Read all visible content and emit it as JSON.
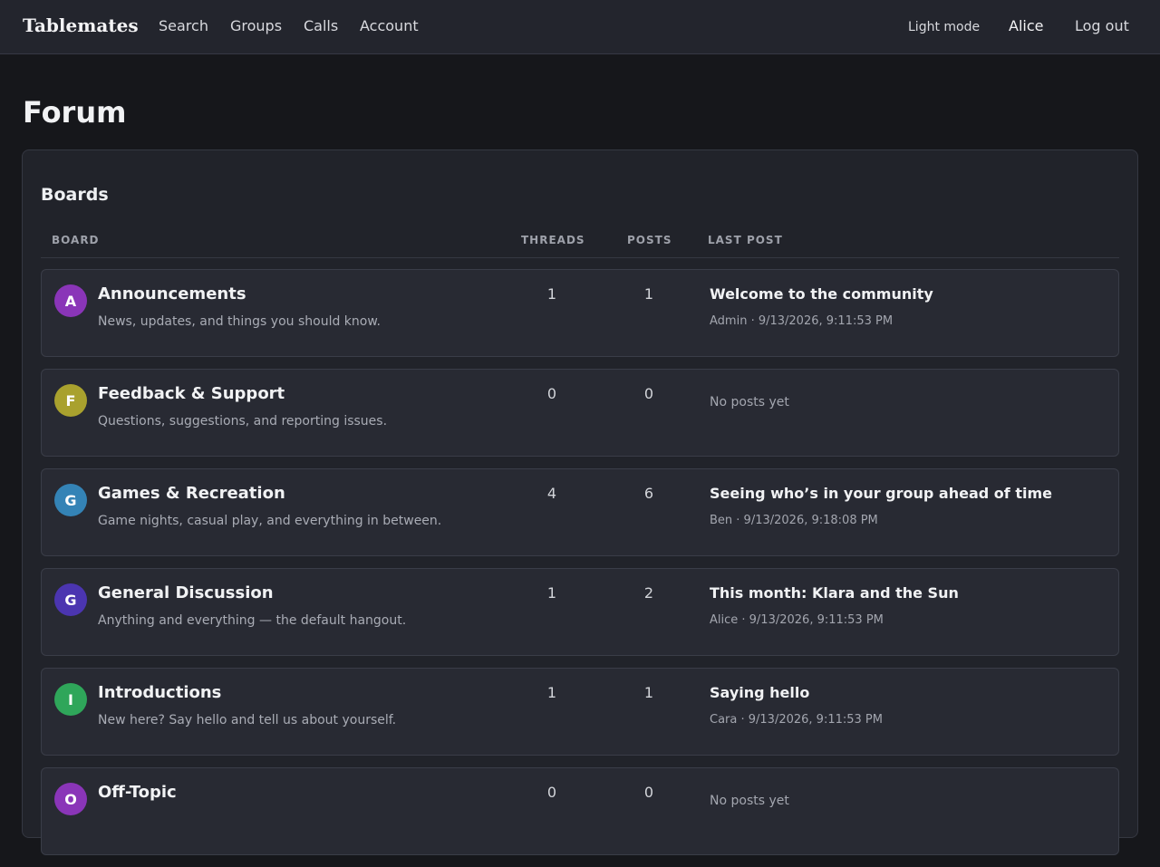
{
  "header": {
    "brand": "Tablemates",
    "nav": [
      "Search",
      "Groups",
      "Calls",
      "Account"
    ],
    "light_mode": "Light mode",
    "user": "Alice",
    "logout": "Log out"
  },
  "page": {
    "title": "Forum"
  },
  "boards": {
    "title": "Boards",
    "columns": [
      "BOARD",
      "THREADS",
      "POSTS",
      "LAST POST"
    ],
    "rows": [
      {
        "initial": "A",
        "color": "#8a35b8",
        "name": "Announcements",
        "desc": "News, updates, and things you should know.",
        "threads": "1",
        "posts": "1",
        "last_title": "Welcome to the community",
        "last_meta": "Admin · 9/13/2026, 9:11:53 PM"
      },
      {
        "initial": "F",
        "color": "#a9a12e",
        "name": "Feedback & Support",
        "desc": "Questions, suggestions, and reporting issues.",
        "threads": "0",
        "posts": "0",
        "last_title": "",
        "last_meta": "",
        "no_posts": "No posts yet"
      },
      {
        "initial": "G",
        "color": "#3483b6",
        "name": "Games & Recreation",
        "desc": "Game nights, casual play, and everything in between.",
        "threads": "4",
        "posts": "6",
        "last_title": "Seeing who’s in your group ahead of time",
        "last_meta": "Ben · 9/13/2026, 9:18:08 PM"
      },
      {
        "initial": "G",
        "color": "#4b35b0",
        "name": "General Discussion",
        "desc": "Anything and everything — the default hangout.",
        "threads": "1",
        "posts": "2",
        "last_title": "This month: Klara and the Sun",
        "last_meta": "Alice · 9/13/2026, 9:11:53 PM"
      },
      {
        "initial": "I",
        "color": "#2fa65a",
        "name": "Introductions",
        "desc": "New here? Say hello and tell us about yourself.",
        "threads": "1",
        "posts": "1",
        "last_title": "Saying hello",
        "last_meta": "Cara · 9/13/2026, 9:11:53 PM"
      },
      {
        "initial": "O",
        "color": "#8a35b8",
        "name": "Off-Topic",
        "desc": "",
        "threads": "0",
        "posts": "0",
        "last_title": "",
        "last_meta": "",
        "no_posts": "No posts yet"
      }
    ]
  }
}
